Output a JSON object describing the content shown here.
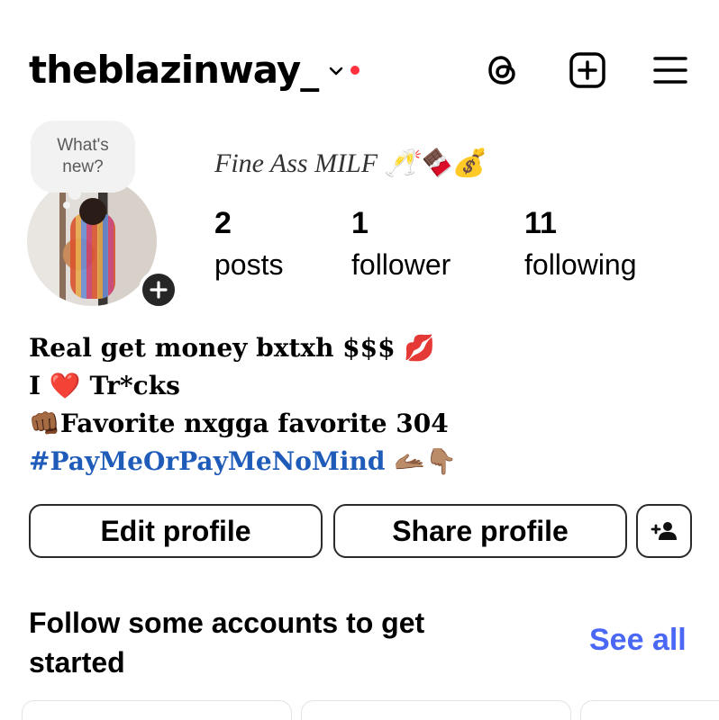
{
  "header": {
    "username": "theblazinway_",
    "icons": [
      "chevron-down-icon",
      "threads-icon",
      "create-post-icon",
      "menu-icon"
    ],
    "notification_color": "#ff3040"
  },
  "profile": {
    "note_bubble": "What's new?",
    "full_name": "Fine Ass MILF 🥂🍫💰",
    "stats": [
      {
        "count": "2",
        "label": "posts"
      },
      {
        "count": "1",
        "label": "follower"
      },
      {
        "count": "11",
        "label": "following"
      }
    ]
  },
  "bio": {
    "line1": "Real get money bxtxh $$$ 💋",
    "line2": "I ❤️ Tr*cks",
    "line3": "👊🏾Favorite nxgga favorite 304",
    "hashtag": "#PayMeOrPayMeNoMind",
    "hashtag_emoji": "🫴🏽👇🏽",
    "hashtag_color": "#1f5bb8"
  },
  "actions": {
    "edit_profile": "Edit profile",
    "share_profile": "Share profile",
    "discover_icon": "add-person-icon"
  },
  "suggestions": {
    "title": "Follow some accounts to get started",
    "see_all": "See all",
    "accent": "#4a67f5"
  }
}
